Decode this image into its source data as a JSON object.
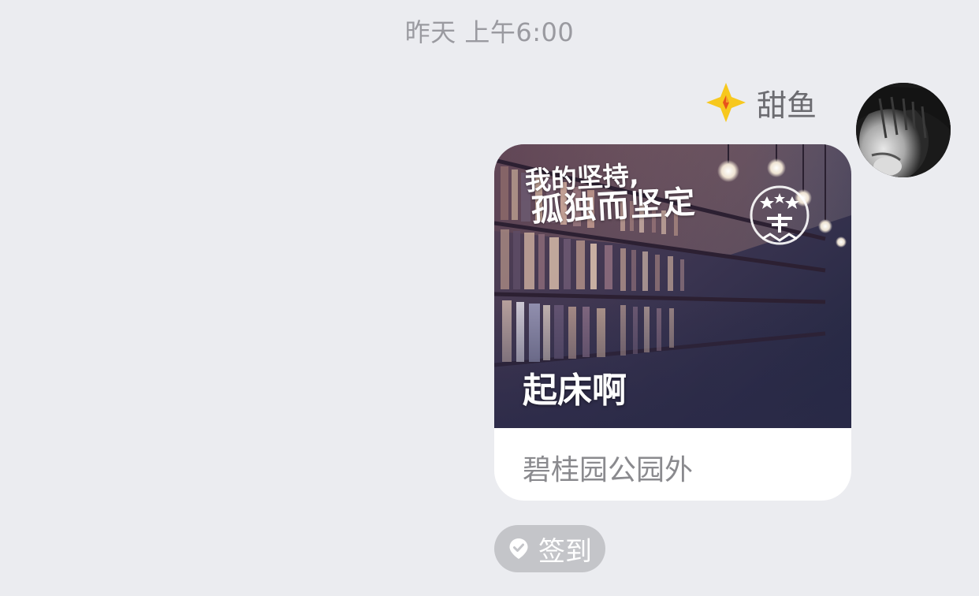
{
  "timestamp": "昨天 上午6:00",
  "sender": {
    "name": "甜鱼",
    "badge_icon": "yellow-star-badge-icon",
    "avatar_icon": "user-avatar"
  },
  "card": {
    "poster_title_line1": "我的坚持,",
    "poster_title_line2": "孤独而坚定",
    "caption": "起床啊",
    "location": "碧桂园公园外"
  },
  "checkin": {
    "label": "签到",
    "icon": "location-check-icon"
  },
  "colors": {
    "background": "#ebecf0",
    "badge_yellow": "#f7c81e",
    "badge_orange": "#e8531c",
    "tag_gray": "#c4c5c9",
    "text_gray": "#8a8a8e"
  }
}
